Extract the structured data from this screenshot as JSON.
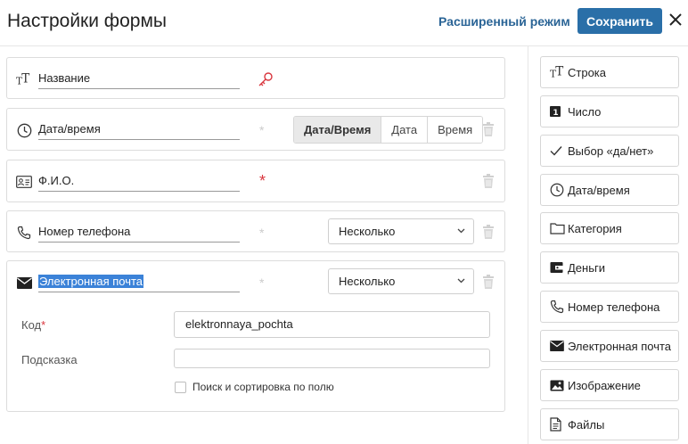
{
  "header": {
    "title": "Настройки формы",
    "advanced_link": "Расширенный режим",
    "save_label": "Сохранить"
  },
  "fields": [
    {
      "name": "Название",
      "icon": "text-type-icon",
      "marker": "key-icon"
    },
    {
      "name": "Дата/время",
      "icon": "clock-icon",
      "segments": [
        "Дата/Время",
        "Дата",
        "Время"
      ],
      "active_segment": "Дата/Время"
    },
    {
      "name": "Ф.И.О.",
      "icon": "id-card-icon",
      "required": true
    },
    {
      "name": "Номер телефона",
      "icon": "phone-icon",
      "select_value": "Несколько"
    },
    {
      "name": "Электронная почта",
      "icon": "envelope-icon",
      "select_value": "Несколько",
      "settings": {
        "code_label": "Код",
        "code_value": "elektronnaya_pochta",
        "hint_label": "Подсказка",
        "hint_value": "",
        "search_checkbox_label": "Поиск и сортировка по полю",
        "search_checked": false
      }
    }
  ],
  "asterisk": "*",
  "types": [
    {
      "label": "Строка",
      "icon": "text-type-icon"
    },
    {
      "label": "Число",
      "icon": "number-icon"
    },
    {
      "label": "Выбор «да/нет»",
      "icon": "checkmark-icon"
    },
    {
      "label": "Дата/время",
      "icon": "clock-icon"
    },
    {
      "label": "Категория",
      "icon": "folder-icon"
    },
    {
      "label": "Деньги",
      "icon": "wallet-icon"
    },
    {
      "label": "Номер телефона",
      "icon": "phone-icon"
    },
    {
      "label": "Электронная почта",
      "icon": "envelope-icon"
    },
    {
      "label": "Изображение",
      "icon": "image-icon"
    },
    {
      "label": "Файлы",
      "icon": "file-icon"
    }
  ]
}
